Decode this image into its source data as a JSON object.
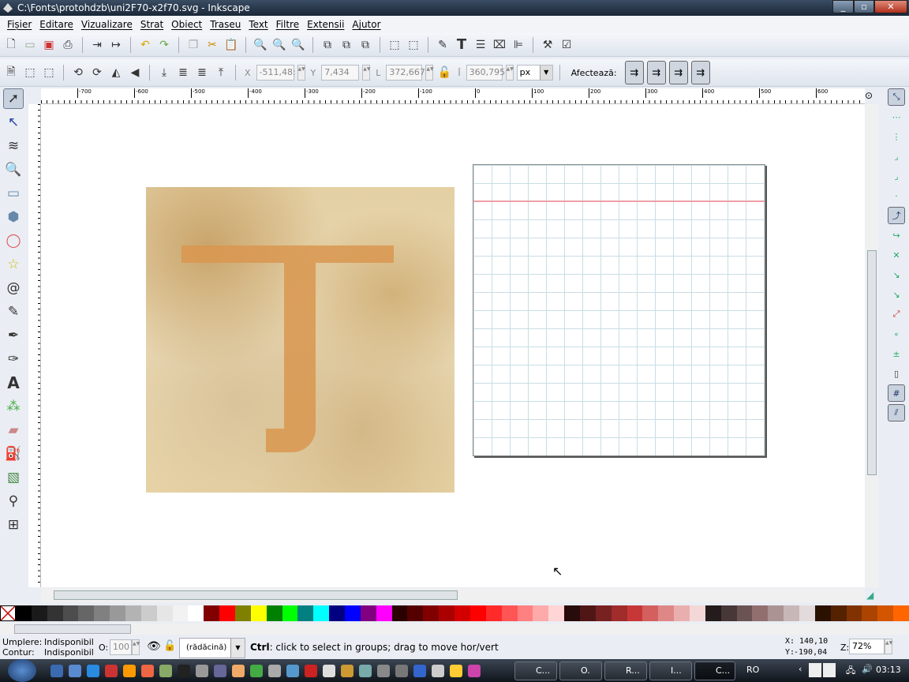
{
  "window": {
    "title": "C:\\Fonts\\protohdzb\\uni2F70-x2f70.svg - Inkscape",
    "minimize": "_",
    "maximize": "▫",
    "close": "✕"
  },
  "menu": [
    "Fișier",
    "Editare",
    "Vizualizare",
    "Strat",
    "Obiect",
    "Traseu",
    "Text",
    "Filtre",
    "Extensii",
    "Ajutor"
  ],
  "select_toolbar": {
    "x_label": "X",
    "x_value": "-511,48:",
    "y_label": "Y",
    "y_value": "7,434",
    "w_label": "L",
    "w_value": "372,667",
    "h_label": "Î",
    "h_value": "360,795",
    "unit": "px",
    "affect_label": "Afectează:"
  },
  "ruler_labels": [
    "-700",
    "-600",
    "-500",
    "-400",
    "-300",
    "-200",
    "-100",
    "0",
    "100",
    "200",
    "300",
    "400",
    "500",
    "600"
  ],
  "palette": [
    "#000000",
    "#1a1a1a",
    "#333333",
    "#4d4d4d",
    "#666666",
    "#808080",
    "#999999",
    "#b3b3b3",
    "#cccccc",
    "#e6e6e6",
    "#f2f2f2",
    "#ffffff",
    "#800000",
    "#ff0000",
    "#808000",
    "#ffff00",
    "#008000",
    "#00ff00",
    "#008080",
    "#00ffff",
    "#000080",
    "#0000ff",
    "#800080",
    "#ff00ff",
    "#2b0000",
    "#550000",
    "#800000",
    "#aa0000",
    "#d40000",
    "#ff0000",
    "#ff2a2a",
    "#ff5555",
    "#ff8080",
    "#ffaaaa",
    "#ffd5d5",
    "#280b0b",
    "#501616",
    "#782121",
    "#a02c2c",
    "#c83737",
    "#d35f5f",
    "#de8787",
    "#e9afaf",
    "#f4d7d7",
    "#241c1c",
    "#483737",
    "#6c5353",
    "#916f6f",
    "#ac9393",
    "#c8b7b7",
    "#e3dbdb",
    "#2b1100",
    "#552200",
    "#803300",
    "#aa4400",
    "#d45500",
    "#ff6600"
  ],
  "status": {
    "fill_label": "Umplere:",
    "fill_value": "Indisponibil",
    "stroke_label": "Contur:",
    "stroke_value": "Indisponibil",
    "opacity_label": "O:",
    "opacity_value": "100",
    "layer": "(rădăcină)",
    "message_key": "Ctrl",
    "message": ": click to select in groups; drag to move hor/vert",
    "cursor_x_label": "X:",
    "cursor_x": "140,10",
    "cursor_y_label": "Y:",
    "cursor_y": "-190,04",
    "zoom_label": "Z:",
    "zoom_value": "72%"
  },
  "taskbar": {
    "buttons": [
      "C...",
      "O.",
      "R...",
      "I...",
      "C..."
    ],
    "lang": "RO",
    "clock": "03:13"
  }
}
